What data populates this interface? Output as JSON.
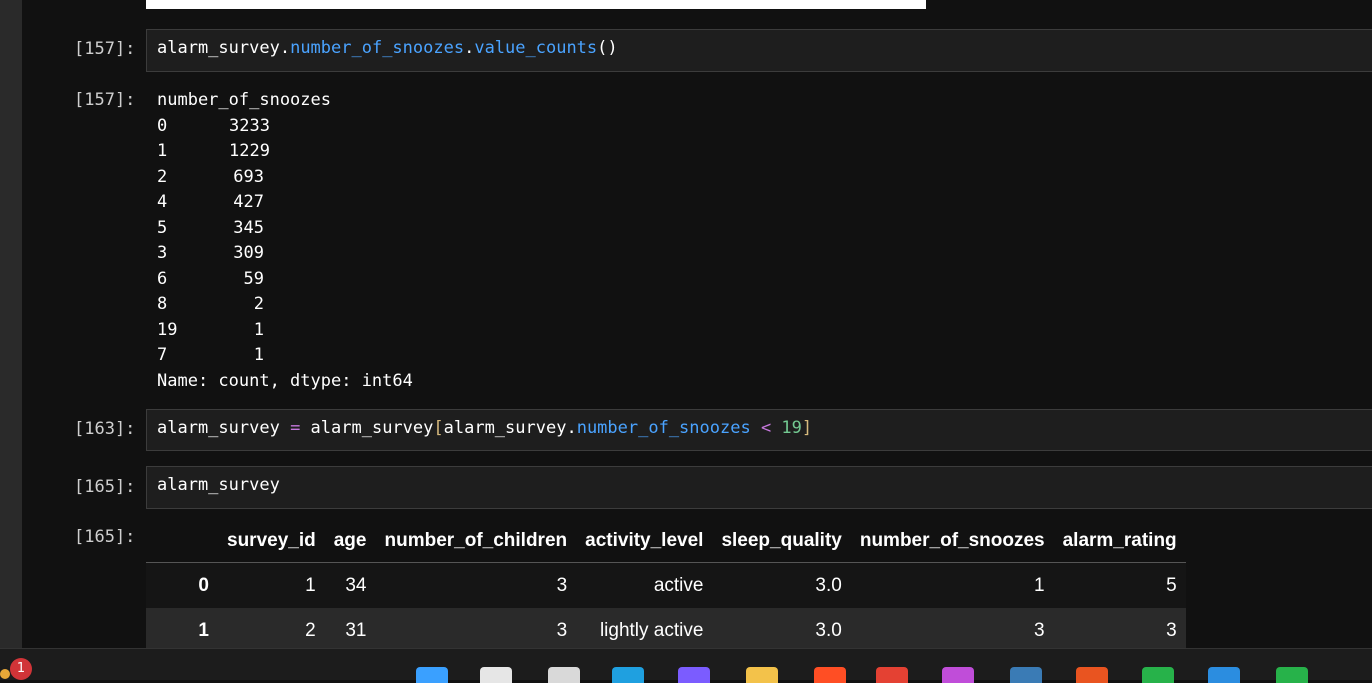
{
  "cells": [
    {
      "prompt": "[157]:",
      "code_tokens": [
        {
          "t": "alarm_survey",
          "c": "var"
        },
        {
          "t": ".",
          "c": "plain"
        },
        {
          "t": "number_of_snoozes",
          "c": "attr"
        },
        {
          "t": ".",
          "c": "plain"
        },
        {
          "t": "value_counts",
          "c": "attr"
        },
        {
          "t": "()",
          "c": "plain"
        }
      ]
    },
    {
      "prompt": "[163]:",
      "code_tokens": [
        {
          "t": "alarm_survey",
          "c": "var"
        },
        {
          "t": " = ",
          "c": "op"
        },
        {
          "t": "alarm_survey",
          "c": "var"
        },
        {
          "t": "[",
          "c": "brk"
        },
        {
          "t": "alarm_survey",
          "c": "var"
        },
        {
          "t": ".",
          "c": "plain"
        },
        {
          "t": "number_of_snoozes",
          "c": "attr"
        },
        {
          "t": " < ",
          "c": "op"
        },
        {
          "t": "19",
          "c": "num"
        },
        {
          "t": "]",
          "c": "brk"
        }
      ]
    },
    {
      "prompt": "[165]:",
      "code_tokens": [
        {
          "t": "alarm_survey",
          "c": "var"
        }
      ]
    }
  ],
  "output_157": {
    "prompt": "[157]:",
    "header": "number_of_snoozes",
    "rows": [
      {
        "idx": "0",
        "val": "3233"
      },
      {
        "idx": "1",
        "val": "1229"
      },
      {
        "idx": "2",
        "val": "693"
      },
      {
        "idx": "4",
        "val": "427"
      },
      {
        "idx": "5",
        "val": "345"
      },
      {
        "idx": "3",
        "val": "309"
      },
      {
        "idx": "6",
        "val": "59"
      },
      {
        "idx": "8",
        "val": "2"
      },
      {
        "idx": "19",
        "val": "1"
      },
      {
        "idx": "7",
        "val": "1"
      }
    ],
    "footer": "Name: count, dtype: int64"
  },
  "output_165": {
    "prompt": "[165]:",
    "columns": [
      "",
      "survey_id",
      "age",
      "number_of_children",
      "activity_level",
      "sleep_quality",
      "number_of_snoozes",
      "alarm_rating"
    ],
    "rows": [
      [
        "0",
        "1",
        "34",
        "3",
        "active",
        "3.0",
        "1",
        "5"
      ],
      [
        "1",
        "2",
        "31",
        "3",
        "lightly active",
        "3.0",
        "3",
        "3"
      ]
    ]
  },
  "taskbar": {
    "notification_count": "1",
    "icons": [
      {
        "name": "start-icon",
        "color": "#3aa0ff"
      },
      {
        "name": "search-icon",
        "color": "#e6e6e6"
      },
      {
        "name": "file-explorer-icon",
        "color": "#d9d9d9"
      },
      {
        "name": "edge-icon",
        "color": "#1fa0e0"
      },
      {
        "name": "copilot-icon",
        "color": "#7b5cff"
      },
      {
        "name": "folder-icon",
        "color": "#f3c24a"
      },
      {
        "name": "brave-icon",
        "color": "#ff4e24"
      },
      {
        "name": "chrome-icon",
        "color": "#e44133"
      },
      {
        "name": "chrome-profile-icon",
        "color": "#c04dd9"
      },
      {
        "name": "mysql-icon",
        "color": "#3a7bb5"
      },
      {
        "name": "ubuntu-icon",
        "color": "#e95420"
      },
      {
        "name": "app-green-icon",
        "color": "#27b24a"
      },
      {
        "name": "vscode-icon",
        "color": "#2b8de0"
      },
      {
        "name": "app-green-2-icon",
        "color": "#27b24a"
      }
    ]
  }
}
